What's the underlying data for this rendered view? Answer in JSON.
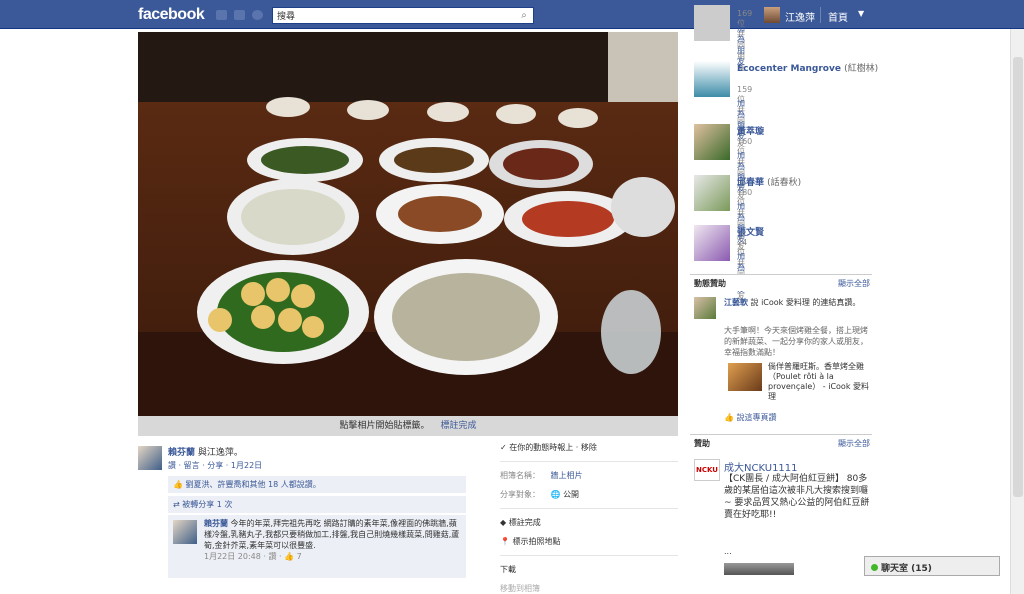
{
  "header": {
    "logo": "facebook",
    "search_value": "搜尋",
    "user_name": "江逸萍",
    "home_label": "首頁"
  },
  "photo": {
    "caption": "點擊相片開始貼標籤。",
    "done_tagging": "標註完成"
  },
  "post": {
    "author": "賴芬蘭",
    "with_text": "與江逸萍。",
    "actions": "讚 · 留言 · 分享 · 1月22日",
    "likes_text": "劉夏洪、許豐喬和其他 18 人都說讚。",
    "shares_text": "被轉分享 1 次",
    "comment": {
      "author": "賴芬蘭",
      "text": "今年的年菜,拜完祖先再吃 網路訂購的素年菜,像裡面的佛跳牆,蘋樣冷盤,乳豬丸子,我都只要稍做加工,排盤,我自己則燒幾樣蔬菜,問雞菇,蘆筍,金針芥菜,素年菜可以很豐盛.",
      "meta": "1月22日 20:48 · 讚 · 👍 7"
    }
  },
  "middle": {
    "hide_timeline": "在你的動態時報上 · 移除",
    "album_label": "相簿名稱：",
    "album_value": "牆上相片",
    "share_label": "分享對象：",
    "share_value": "公開",
    "tag_done": "標註完成",
    "location": "標示拍照地點",
    "download": "下載",
    "more": "移動到相簿"
  },
  "sidebar": {
    "people": [
      {
        "name": "",
        "alt": "",
        "mutual": "169 位共同朋友",
        "add": "加為朋友"
      },
      {
        "name": "Ecocenter Mangrove",
        "alt": "(紅樹林)",
        "mutual": "159 位共同朋友",
        "add": "加為朋友"
      },
      {
        "name": "黃萃璇",
        "alt": "",
        "mutual": "160 位共同朋友",
        "add": "加為朋友"
      },
      {
        "name": "邱春華",
        "alt": "(話春秋)",
        "mutual": "180 位共同朋友",
        "add": "加為朋友"
      },
      {
        "name": "張文賢",
        "alt": "",
        "mutual": "24 位共同朋友",
        "add": "加為朋友"
      }
    ],
    "activity_title": "動態贊助",
    "show_all": "顯示全部",
    "activity": {
      "author": "江藝軟",
      "text": "說 iCook 愛料理 的連結真讚。",
      "body": "大手筆啊！今天來個烤雞全餐，搭上現烤的新鮮蔬菜、一起分享你的家人或朋友，幸福指數滿點！",
      "link_title": "倘佯普羅旺斯。香草烤全雞（Poulet rôti à la provençale） - iCook 愛料理",
      "like": "說這專頁讚"
    },
    "sponsored_title": "贊助",
    "ad": {
      "title": "成大NCKU1111",
      "body": "【CK團長 / 成大阿伯紅豆餅】 80多歲的某居伯這次被非凡大搜索搜到囉~ 要求品質又熱心公益的阿伯紅豆餅賣在好吃耶!!",
      "more": "..."
    }
  },
  "chat": {
    "label": "聊天室 (15)"
  },
  "colors": {
    "brand": "#3b5998",
    "bar": "#3b5998"
  }
}
